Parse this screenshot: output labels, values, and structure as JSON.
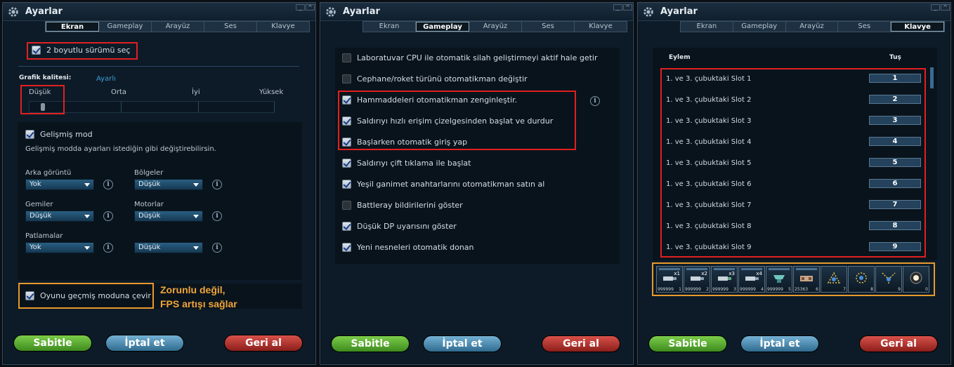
{
  "panels": [
    {
      "title": "Ayarlar",
      "tabs": [
        "Ekran",
        "Gameplay",
        "Arayüz",
        "Ses",
        "Klavye"
      ],
      "active_tab": "Ekran",
      "two_d_checkbox": {
        "label": "2 boyutlu sürümü seç",
        "checked": true
      },
      "quality": {
        "label": "Grafik kalitesi:",
        "value": "Ayarlı",
        "levels": [
          "Düşük",
          "Orta",
          "İyi",
          "Yüksek"
        ],
        "selected": "Düşük"
      },
      "advanced": {
        "checkbox_label": "Gelişmiş mod",
        "checked": true,
        "description": "Gelişmiş modda ayarları istediğin gibi değiştirebilirsin.",
        "settings": [
          {
            "label": "Arka görüntü",
            "value": "Yok"
          },
          {
            "label": "Bölgeler",
            "value": "Düşük"
          },
          {
            "label": "Gemiler",
            "value": "Düşük"
          },
          {
            "label": "Motorlar",
            "value": "Düşük"
          },
          {
            "label": "Patlamalar",
            "value": "Yok"
          },
          {
            "label": "",
            "value": "Düşük"
          }
        ]
      },
      "legacy_checkbox": {
        "label": "Oyunu geçmiş moduna çevir",
        "checked": true
      },
      "annotation": [
        "Zorunlu değil,",
        "FPS artışı sağlar"
      ]
    },
    {
      "title": "Ayarlar",
      "tabs": [
        "Ekran",
        "Gameplay",
        "Arayüz",
        "Ses",
        "Klavye"
      ],
      "active_tab": "Gameplay",
      "options": [
        {
          "label": "Laboratuvar CPU ile otomatik silah geliştirmeyi aktif hale getir",
          "checked": false
        },
        {
          "label": "Cephane/roket türünü otomatikman değiştir",
          "checked": false
        },
        {
          "label": "Hammaddeleri otomatikman zenginleştir.",
          "checked": true
        },
        {
          "label": "Saldırıyı hızlı erişim çizelgesinden başlat ve durdur",
          "checked": true
        },
        {
          "label": "Başlarken otomatik giriş yap",
          "checked": true
        },
        {
          "label": "Saldırıyı çift tıklama ile başlat",
          "checked": true
        },
        {
          "label": "Yeşil ganimet anahtarlarını otomatikman satın al",
          "checked": true
        },
        {
          "label": "Battleray bildirilerini göster",
          "checked": false
        },
        {
          "label": "Düşük DP uyarısını göster",
          "checked": true
        },
        {
          "label": "Yeni nesneleri otomatik donan",
          "checked": true
        }
      ]
    },
    {
      "title": "Ayarlar",
      "tabs": [
        "Ekran",
        "Gameplay",
        "Arayüz",
        "Ses",
        "Klavye"
      ],
      "active_tab": "Klavye",
      "columns": {
        "action": "Eylem",
        "key": "Tuş"
      },
      "bindings": [
        {
          "action": "1. ve 3. çubuktaki Slot 1",
          "key": "1"
        },
        {
          "action": "1. ve 3. çubuktaki Slot 2",
          "key": "2"
        },
        {
          "action": "1. ve 3. çubuktaki Slot 3",
          "key": "3"
        },
        {
          "action": "1. ve 3. çubuktaki Slot 4",
          "key": "4"
        },
        {
          "action": "1. ve 3. çubuktaki Slot 5",
          "key": "5"
        },
        {
          "action": "1. ve 3. çubuktaki Slot 6",
          "key": "6"
        },
        {
          "action": "1. ve 3. çubuktaki Slot 7",
          "key": "7"
        },
        {
          "action": "1. ve 3. çubuktaki Slot 8",
          "key": "8"
        },
        {
          "action": "1. ve 3. çubuktaki Slot 9",
          "key": "9"
        }
      ],
      "quickbar": [
        {
          "qty": "999999",
          "num": "1",
          "badge": "x1"
        },
        {
          "qty": "999999",
          "num": "2",
          "badge": "x2"
        },
        {
          "qty": "999999",
          "num": "3",
          "badge": "x3"
        },
        {
          "qty": "999999",
          "num": "4",
          "badge": "x4"
        },
        {
          "qty": "999999",
          "num": "5",
          "badge": ""
        },
        {
          "qty": "25363",
          "num": "6",
          "badge": ""
        },
        {
          "qty": "",
          "num": "7",
          "badge": ""
        },
        {
          "qty": "",
          "num": "8",
          "badge": ""
        },
        {
          "qty": "",
          "num": "9",
          "badge": ""
        },
        {
          "qty": "",
          "num": "0",
          "badge": ""
        }
      ]
    }
  ],
  "buttons": {
    "confirm": "Sabitle",
    "cancel": "İptal et",
    "revert": "Geri al"
  },
  "colors": {
    "highlight_red": "#e02020",
    "highlight_orange": "#e89a2c",
    "annotation_text": "#f0a53a",
    "link_blue": "#3d9bd6"
  }
}
